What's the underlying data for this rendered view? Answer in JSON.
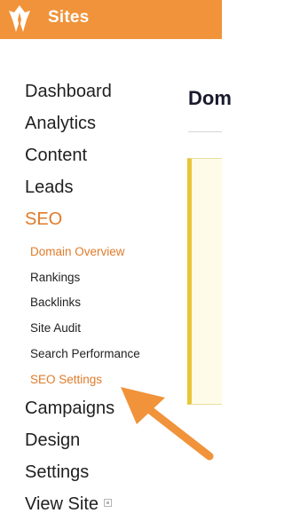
{
  "header": {
    "app_title": "Sites",
    "logo_icon": "raven-leaf-logo-icon",
    "background_color": "#f0933a"
  },
  "sidebar": {
    "items": [
      {
        "label": "Dashboard",
        "active": false
      },
      {
        "label": "Analytics",
        "active": false
      },
      {
        "label": "Content",
        "active": false
      },
      {
        "label": "Leads",
        "active": false
      },
      {
        "label": "SEO",
        "active": true
      },
      {
        "label": "Campaigns",
        "active": false
      },
      {
        "label": "Design",
        "active": false
      },
      {
        "label": "Settings",
        "active": false
      },
      {
        "label": "View Site",
        "active": false,
        "icon": "external-link-icon"
      }
    ],
    "seo_subitems": [
      {
        "label": "Domain Overview",
        "active": true
      },
      {
        "label": "Rankings",
        "active": false
      },
      {
        "label": "Backlinks",
        "active": false
      },
      {
        "label": "Site Audit",
        "active": false
      },
      {
        "label": "Search Performance",
        "active": false
      },
      {
        "label": "SEO Settings",
        "active": true
      }
    ],
    "accent_color": "#e07b2a"
  },
  "main": {
    "heading": "Dom"
  },
  "annotation": {
    "icon": "pointer-arrow-icon",
    "color": "#f0933a"
  }
}
